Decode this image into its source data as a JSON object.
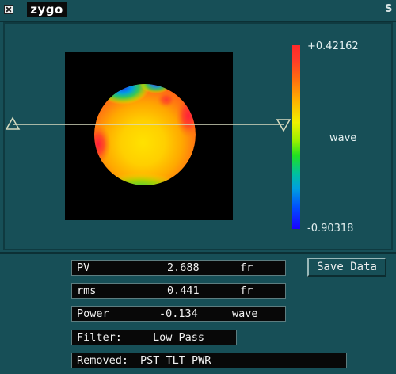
{
  "window": {
    "logo_text": "zygo",
    "title_edge": "S"
  },
  "plot": {
    "colorbar_max": "+0.42162",
    "colorbar_min": "-0.90318",
    "colorbar_unit": "wave",
    "colors": {
      "high": "#ff2a2a",
      "mid": "#f0f000",
      "low": "#1a00ff"
    }
  },
  "readouts": {
    "pv": {
      "label": "PV",
      "value": "2.688",
      "unit": "fr"
    },
    "rms": {
      "label": "rms",
      "value": "0.441",
      "unit": "fr"
    },
    "power": {
      "label": "Power",
      "value": "-0.134",
      "unit": "wave"
    },
    "filter": {
      "label": "Filter:",
      "value": "Low Pass"
    },
    "removed": {
      "label": "Removed:",
      "value": "PST TLT PWR"
    }
  },
  "buttons": {
    "save_data": "Save Data"
  }
}
